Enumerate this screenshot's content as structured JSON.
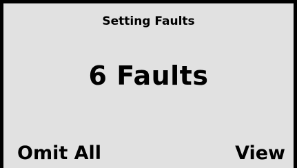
{
  "screen": {
    "title": "Setting Faults",
    "count_label": "6 Faults",
    "background": "#e1e1e1",
    "border_color": "#000000"
  },
  "softkeys": {
    "left_label": "Omit All",
    "right_label": "View"
  }
}
